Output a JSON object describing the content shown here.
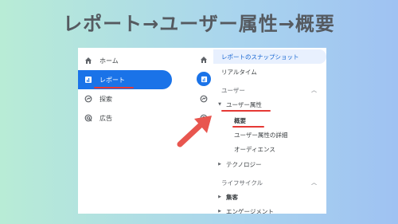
{
  "headline": "レポート→ユーザー属性→概要",
  "nav": {
    "items": [
      {
        "label": "ホーム",
        "icon": "home-icon"
      },
      {
        "label": "レポート",
        "icon": "bar-chart-icon",
        "active": true
      },
      {
        "label": "探索",
        "icon": "explore-icon"
      },
      {
        "label": "広告",
        "icon": "ads-icon"
      }
    ]
  },
  "subnav": {
    "snapshot": "レポートのスナップショット",
    "realtime": "リアルタイム",
    "user_section": "ユーザー",
    "demographics": "ユーザー属性",
    "overview": "概要",
    "demographic_details": "ユーザー属性の詳細",
    "audiences": "オーディエンス",
    "tech": "テクノロジー",
    "lifecycle_section": "ライフサイクル",
    "acquisition": "集客",
    "engagement": "エンゲージメント"
  },
  "colors": {
    "accent": "#1a73e8",
    "highlight_bg": "#e8f0fe",
    "annotation_red": "#e53935"
  }
}
